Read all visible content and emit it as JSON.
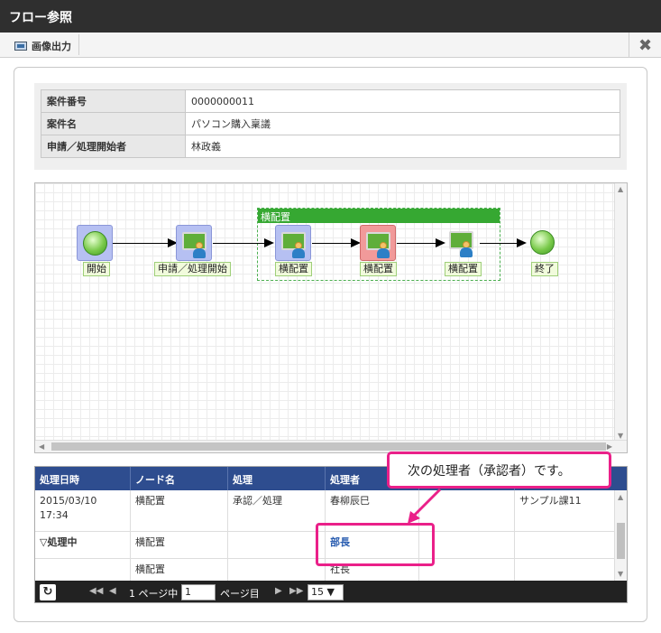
{
  "window": {
    "title": "フロー参照"
  },
  "toolbar": {
    "export_label": "画像出力",
    "close_glyph": "✖"
  },
  "info": {
    "rows": [
      {
        "key": "案件番号",
        "value": "0000000011"
      },
      {
        "key": "案件名",
        "value": "パソコン購入稟議"
      },
      {
        "key": "申請／処理開始者",
        "value": "林政義"
      }
    ]
  },
  "diagram": {
    "lane_title": "横配置",
    "nodes": [
      {
        "label": "開始"
      },
      {
        "label": "申請／処理開始"
      },
      {
        "label": "横配置"
      },
      {
        "label": "横配置"
      },
      {
        "label": "横配置"
      },
      {
        "label": "終了"
      }
    ]
  },
  "history": {
    "headers": [
      "処理日時",
      "ノード名",
      "処理",
      "処理者",
      "",
      ""
    ],
    "rows": [
      {
        "date": "2015/03/10",
        "time": "17:34",
        "node": "横配置",
        "action": "承認／処理",
        "user": "春柳辰巳",
        "col5": "",
        "col6": "サンプル課11"
      },
      {
        "date": "▽処理中",
        "time": "",
        "node": "横配置",
        "action": "",
        "user": "部長",
        "col5": "",
        "col6": ""
      },
      {
        "date": "",
        "time": "",
        "node": "横配置",
        "action": "",
        "user": "社長",
        "col5": "",
        "col6": ""
      }
    ]
  },
  "pager": {
    "page_of": "1 ページ中",
    "page_value": "1",
    "page_suffix": "ページ目",
    "per_page": "15 ▼"
  },
  "callout": {
    "text": "次の処理者（承認者）です。"
  },
  "colors": {
    "accent": "#ea2089",
    "header": "#2e4d8f",
    "lane": "#36a832"
  }
}
